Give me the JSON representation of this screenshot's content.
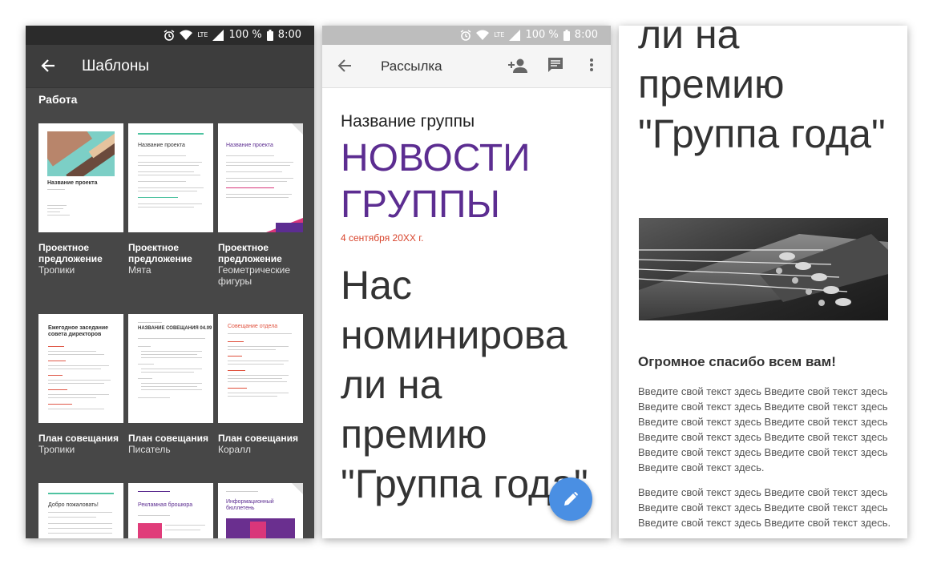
{
  "status_bar": {
    "battery": "100 %",
    "time": "8:00",
    "network": "LTE"
  },
  "templates_screen": {
    "title": "Шаблоны",
    "section": "Работа",
    "items": [
      {
        "name": "Проектное предложение",
        "subtitle": "Тропики"
      },
      {
        "name": "Проектное предложение",
        "subtitle": "Мята"
      },
      {
        "name": "Проектное предложение",
        "subtitle": "Геометрические фигуры"
      },
      {
        "name": "План совещания",
        "subtitle": "Тропики"
      },
      {
        "name": "План совещания",
        "subtitle": "Писатель"
      },
      {
        "name": "План совещания",
        "subtitle": "Коралл"
      }
    ],
    "thumb_texts": {
      "t1": "Название проекта",
      "t2": "Название проекта",
      "t3": "Название проекта",
      "t4": "Ежегодное заседание совета директоров",
      "t5": "НАЗВАНИЕ СОВЕЩАНИЯ 04.09",
      "t6": "Совещание отдела",
      "t7": "Добро пожаловать!",
      "t8": "Рекламная брошюра",
      "t9": "Информационный бюллетень"
    }
  },
  "newsletter_screen": {
    "title": "Рассылка",
    "group_name": "Название группы",
    "news_title": "НОВОСТИ ГРУППЫ",
    "date": "4 сентября 20XX г.",
    "headline": "Нас номинирова ли на премию \"Группа года\""
  },
  "document_screen": {
    "headline": "ли на премию \"Группа года\"",
    "thanks": "Огромное спасибо всем вам!",
    "paragraph1": "Введите свой текст здесь Введите свой текст здесь Введите свой текст здесь Введите свой текст здесь Введите свой текст здесь Введите свой текст здесь Введите свой текст здесь Введите свой текст здесь Введите свой текст здесь Введите свой текст здесь Введите свой текст здесь.",
    "paragraph2": "Введите свой текст здесь Введите свой текст здесь Введите свой текст здесь Введите свой текст здесь Введите свой текст здесь Введите свой текст здесь."
  },
  "colors": {
    "accent_purple": "#5c2d91",
    "date_red": "#d8432b",
    "fab_blue": "#4a8fe3",
    "dark_bg": "#474747"
  }
}
